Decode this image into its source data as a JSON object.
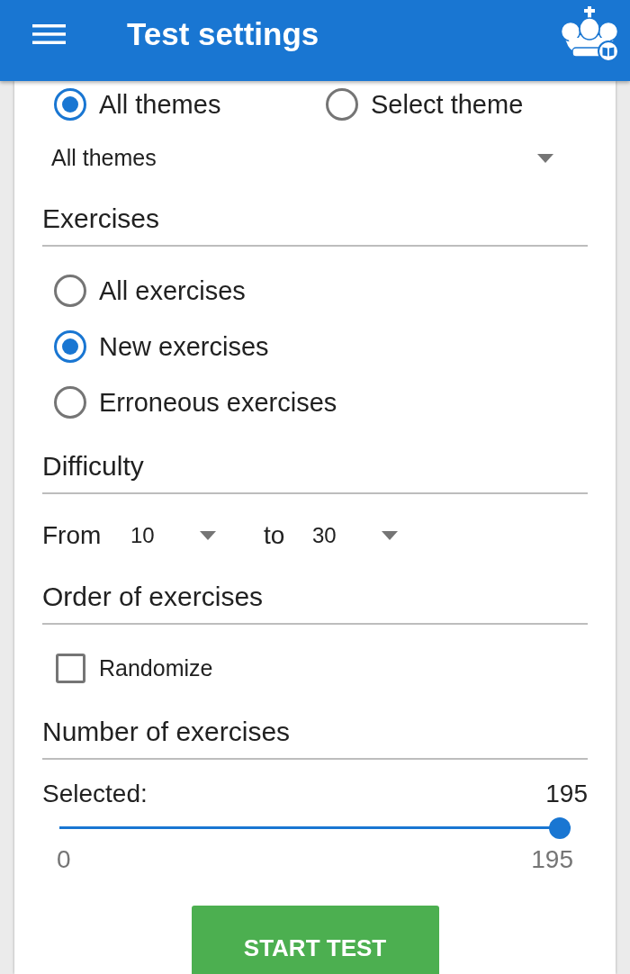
{
  "app_bar": {
    "title": "Test settings"
  },
  "theme_choice": [
    {
      "label": "All themes",
      "selected": true
    },
    {
      "label": "Select theme",
      "selected": false
    }
  ],
  "theme_dropdown": {
    "value": "All themes"
  },
  "exercises": {
    "heading": "Exercises",
    "options": [
      {
        "label": "All exercises",
        "selected": false
      },
      {
        "label": "New exercises",
        "selected": true
      },
      {
        "label": "Erroneous exercises",
        "selected": false
      }
    ]
  },
  "difficulty": {
    "heading": "Difficulty",
    "from_label": "From",
    "from_value": "10",
    "to_label": "to",
    "to_value": "30"
  },
  "order": {
    "heading": "Order of exercises",
    "randomize": {
      "label": "Randomize",
      "checked": false
    }
  },
  "count": {
    "heading": "Number of exercises",
    "selected_label": "Selected:",
    "selected_value": "195",
    "slider": {
      "level": 1
    },
    "min_label": "0",
    "max_label": "195"
  },
  "start_button": {
    "label": "START TEST"
  }
}
